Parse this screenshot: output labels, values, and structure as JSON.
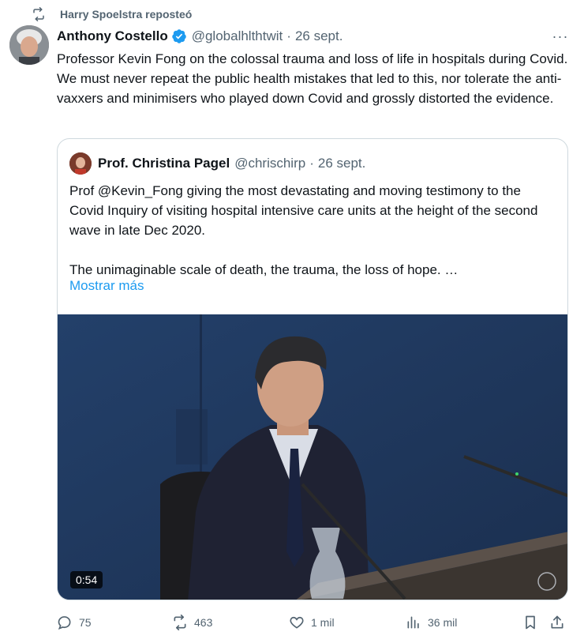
{
  "repost_label": "Harry Spoelstra reposteó",
  "tweet": {
    "author_name": "Anthony Costello",
    "handle": "@globalhlthtwit",
    "separator": "·",
    "date": "26 sept.",
    "more_label": "···",
    "text": "Professor Kevin Fong on the colossal trauma and loss of life in hospitals during Covid. We must never repeat the public health mistakes that led to this, nor tolerate the anti-vaxxers and minimisers who played down Covid and grossly distorted the evidence."
  },
  "quote": {
    "author_name": "Prof. Christina Pagel",
    "handle": "@chrischirp",
    "separator": "·",
    "date": "26 sept.",
    "paragraph1": "Prof @Kevin_Fong  giving the most devastating and moving testimony to the Covid Inquiry of visiting hospital intensive care units at the height of the second wave in late Dec 2020.",
    "paragraph2": "The unimaginable scale of death, the trauma, the loss of hope. …",
    "show_more": "Mostrar más",
    "video_duration": "0:54"
  },
  "actions": {
    "replies": "75",
    "reposts": "463",
    "likes": "1 mil",
    "views": "36 mil"
  },
  "colors": {
    "text": "#0f1419",
    "secondary": "#536471",
    "link": "#1d9bf0",
    "verified": "#1d9bf0",
    "border": "#cfd9de"
  },
  "icons": [
    "repost-icon",
    "verified-icon",
    "more-icon",
    "reply-icon",
    "like-icon",
    "views-icon",
    "bookmark-icon",
    "share-icon"
  ]
}
